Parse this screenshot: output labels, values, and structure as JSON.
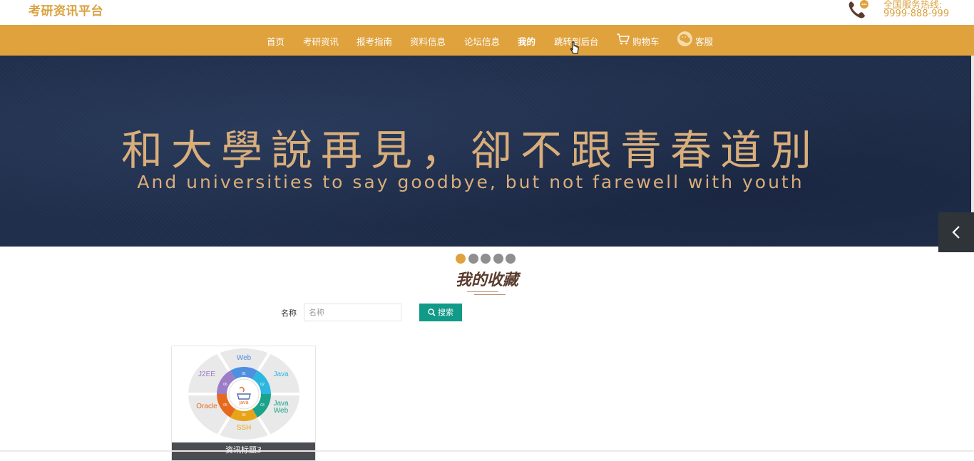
{
  "header": {
    "site_title": "考研资讯平台",
    "hotline_label": "全国服务热线:",
    "hotline_number": "9999-888-999"
  },
  "nav": {
    "items": [
      {
        "label": "首页"
      },
      {
        "label": "考研资讯"
      },
      {
        "label": "报考指南"
      },
      {
        "label": "资料信息"
      },
      {
        "label": "论坛信息"
      },
      {
        "label": "我的",
        "active": true
      },
      {
        "label": "跳转到后台"
      },
      {
        "label": "购物车",
        "icon": "cart-icon"
      },
      {
        "label": "客服",
        "icon": "wechat-icon"
      }
    ]
  },
  "banner": {
    "title_cn": "和大學說再見，卻不跟青春道別",
    "title_en": "And universities to say goodbye, but not farewell with youth",
    "slide_count": 5,
    "active_slide": 1
  },
  "main": {
    "section_title": "我的收藏",
    "search": {
      "label": "名称",
      "placeholder": "名称",
      "value": "",
      "button_label": "搜索"
    },
    "favorites": [
      {
        "caption": "资讯标题3",
        "image_labels": {
          "center": "java",
          "web": "Web",
          "java": "Java",
          "javaweb_line1": "Java",
          "javaweb_line2": "Web",
          "ssh": "SSH",
          "oracle": "Oracle",
          "j2ee": "J2EE",
          "n1": "01",
          "n2": "02",
          "n3": "03",
          "n4": "04",
          "n5": "05",
          "n6": "06"
        }
      }
    ]
  },
  "colors": {
    "brand": "#dfa23d",
    "banner_bg": "#1f2e4b",
    "search_button": "#119a88",
    "title": "#5a3b2e"
  }
}
